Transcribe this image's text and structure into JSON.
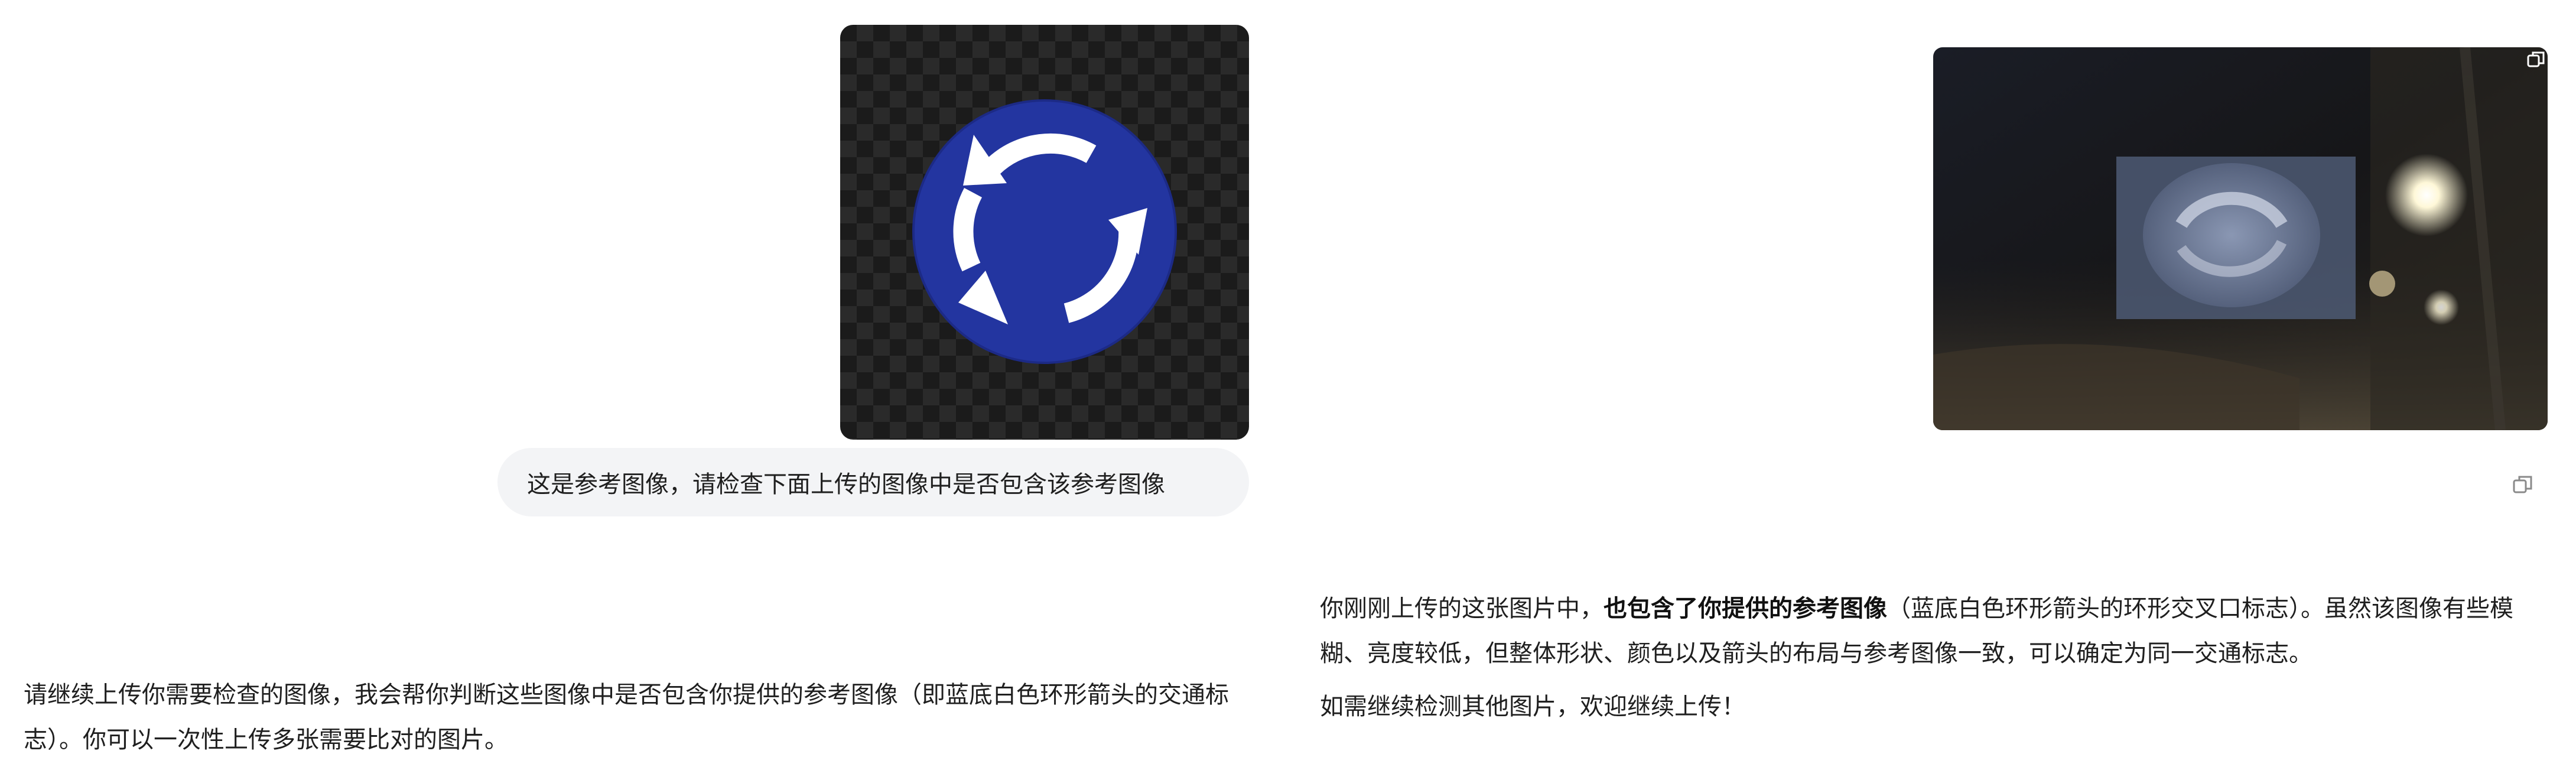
{
  "left_panel": {
    "user_message": "这是参考图像，请检查下面上传的图像中是否包含该参考图像",
    "assistant_reply": "请继续上传你需要检查的图像，我会帮你判断这些图像中是否包含你提供的参考图像（即蓝底白色环形箭头的交通标志）。你可以一次性上传多张需要比对的图片。"
  },
  "right_panel": {
    "answer_intro": "你刚刚上传的这张图片中，",
    "answer_bold": "也包含了你提供的参考图像",
    "answer_rest": "（蓝底白色环形箭头的环形交叉口标志）。虽然该图像有些模糊、亮度较低，但整体形状、颜色以及箭头的布局与参考图像一致，可以确定为同一交通标志。",
    "answer_followup": "如需继续检测其他图片，欢迎继续上传！"
  },
  "colors": {
    "sign_blue": "#2335a0",
    "bubble_bg": "#f3f4f6",
    "text": "#1f1f1f"
  },
  "icons": {
    "sign": "roundabout-sign-icon",
    "copy": "copy-icon"
  }
}
